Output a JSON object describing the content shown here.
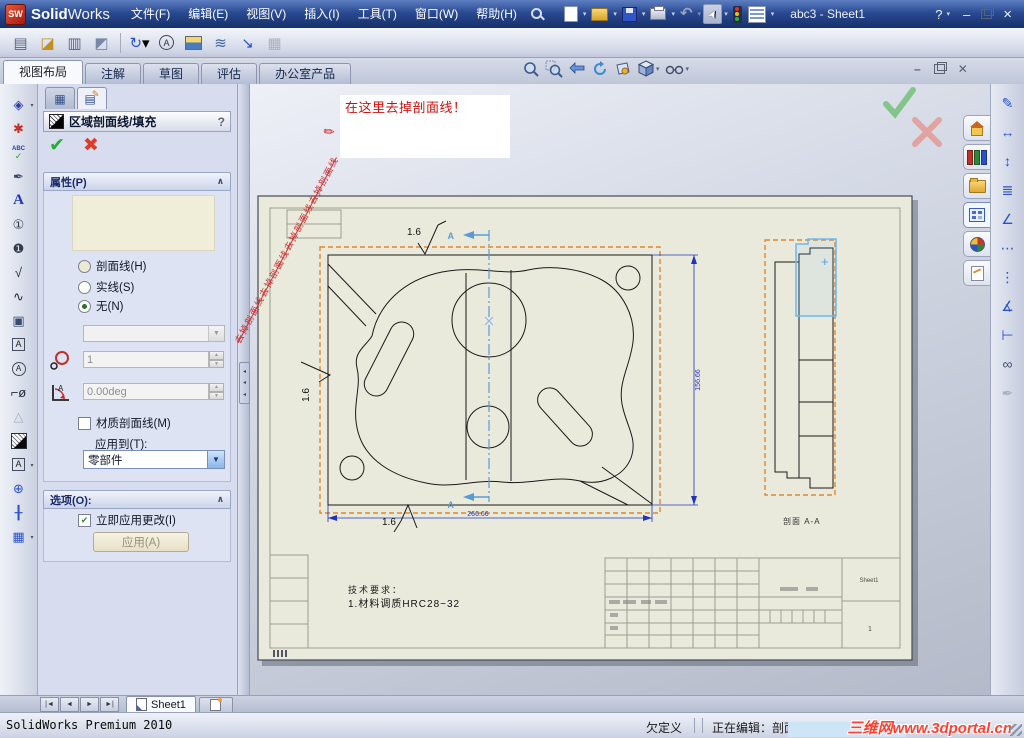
{
  "titlebar": {
    "logo_text": "SW",
    "brand_bold": "Solid",
    "brand_light": "Works",
    "menus": [
      "文件(F)",
      "编辑(E)",
      "视图(V)",
      "插入(I)",
      "工具(T)",
      "窗口(W)",
      "帮助(H)"
    ],
    "doc_title": "abc3 - Sheet1",
    "help_label": "?",
    "minimize": "–",
    "close": "×"
  },
  "quick_toolbar": [
    "new-document",
    "open-document",
    "save-document",
    "print-document",
    "undo",
    "select-cursor",
    "rebuild-traffic-light",
    "options-list"
  ],
  "standard_toolbar": [
    {
      "name": "new-drawing-view-icon",
      "glyph": "▤",
      "color": "#5a6480"
    },
    {
      "name": "model-view-icon",
      "glyph": "◪",
      "color": "#c09020"
    },
    {
      "name": "projected-view-icon",
      "glyph": "▥",
      "color": "#5a6480"
    },
    {
      "name": "auxiliary-view-icon",
      "glyph": "◩",
      "color": "#7a88a8",
      "sep_after": true
    },
    {
      "name": "update-view-icon",
      "glyph": "↻",
      "color": "#2a52c8",
      "dropdown": true
    },
    {
      "name": "detail-view-icon",
      "glyph": "A",
      "kind": "round",
      "color": "#334"
    },
    {
      "name": "section-view-icon",
      "kind": "landscape"
    },
    {
      "name": "break-view-icon",
      "glyph": "≋",
      "color": "#3a6aa8"
    },
    {
      "name": "crop-view-icon",
      "glyph": "↘",
      "color": "#2a52c8"
    },
    {
      "name": "empty-view-table-icon",
      "glyph": "▦",
      "color": "#a8b0c0",
      "disabled": true
    }
  ],
  "command_tabs": [
    {
      "label": "视图布局",
      "active": true
    },
    {
      "label": "注解",
      "active": false
    },
    {
      "label": "草图",
      "active": false
    },
    {
      "label": "评估",
      "active": false
    },
    {
      "label": "办公室产品",
      "active": false
    }
  ],
  "headsup_toolbar": [
    "zoom-to-fit",
    "zoom-to-area",
    "previous-view",
    "redraw",
    "3d-drawing-view",
    "view-orientation",
    "hide-show-items"
  ],
  "annotation_toolbar": [
    {
      "name": "smart-dimension-icon",
      "glyph": "◈",
      "color": "#2a3fb0",
      "dropdown": true
    },
    {
      "name": "model-items-icon",
      "glyph": "✱",
      "color": "#c03028"
    },
    {
      "name": "spell-checker-icon",
      "kind": "abc",
      "glyph": "ABC",
      "sub": "✓"
    },
    {
      "name": "format-painter-icon",
      "glyph": "✒",
      "color": "#3a4a70"
    },
    {
      "name": "note-icon",
      "glyph": "A",
      "color": "#2233bb",
      "kind": "bigA"
    },
    {
      "name": "balloon-icon",
      "glyph": "①",
      "color": "#333a4a"
    },
    {
      "name": "auto-balloon-icon",
      "glyph": "❶",
      "color": "#333a4a"
    },
    {
      "name": "surface-finish-icon",
      "glyph": "√",
      "color": "#222a3a"
    },
    {
      "name": "weld-symbol-icon",
      "glyph": "∿",
      "color": "#222a3a"
    },
    {
      "name": "hole-callout-icon",
      "glyph": "▣",
      "color": "#3a4a70"
    },
    {
      "name": "datum-feature-icon",
      "glyph": "A",
      "kind": "boxed"
    },
    {
      "name": "datum-target-icon",
      "glyph": "A",
      "kind": "round"
    },
    {
      "name": "geometric-tolerance-icon",
      "glyph": "⌐ø",
      "color": "#222a3a"
    },
    {
      "name": "revision-symbol-icon",
      "glyph": "△",
      "color": "#a8b0c0",
      "disabled": true
    },
    {
      "name": "area-hatch-fill-icon",
      "kind": "hatch"
    },
    {
      "name": "blocks-icon",
      "glyph": "A",
      "kind": "boxed",
      "dropdown": true
    },
    {
      "name": "center-mark-icon",
      "glyph": "⊕",
      "color": "#2a52c8"
    },
    {
      "name": "centerline-icon",
      "glyph": "╂",
      "color": "#2a52c8"
    },
    {
      "name": "tables-icon",
      "glyph": "▦",
      "color": "#2a52c8",
      "dropdown": true
    }
  ],
  "dimension_toolbar": [
    {
      "name": "smart-dimension-icon",
      "glyph": "✎",
      "color": "#2a52c8"
    },
    {
      "name": "horizontal-dimension-icon",
      "glyph": "↔",
      "color": "#2a52c8"
    },
    {
      "name": "vertical-dimension-icon",
      "glyph": "↕",
      "color": "#2a52c8"
    },
    {
      "name": "baseline-dimension-icon",
      "glyph": "≣",
      "color": "#2a52c8"
    },
    {
      "name": "ordinate-dimension-icon",
      "glyph": "∠",
      "color": "#2a52c8"
    },
    {
      "name": "horizontal-ordinate-icon",
      "glyph": "⋯",
      "color": "#2a52c8"
    },
    {
      "name": "vertical-ordinate-icon",
      "glyph": "⋮",
      "color": "#2a52c8"
    },
    {
      "name": "chamfer-dimension-icon",
      "glyph": "∡",
      "color": "#2a52c8"
    },
    {
      "name": "datum-dimension-icon",
      "glyph": "⊢",
      "color": "#2a52c8"
    },
    {
      "name": "hide-show-annotations-icon",
      "glyph": "∞",
      "color": "#44506a"
    },
    {
      "name": "format-painter-icon",
      "glyph": "✒",
      "color": "#a8b0c0",
      "disabled": true
    }
  ],
  "taskpane_tabs": [
    {
      "name": "solidworks-resources-tab",
      "icon": "home",
      "active": false
    },
    {
      "name": "design-library-tab",
      "icon": "books",
      "active": false
    },
    {
      "name": "file-explorer-tab",
      "icon": "folder",
      "active": false
    },
    {
      "name": "view-palette-tab",
      "icon": "palette",
      "active": true
    },
    {
      "name": "appearances-tab",
      "icon": "sphere",
      "active": false
    },
    {
      "name": "custom-properties-tab",
      "icon": "page",
      "active": false
    }
  ],
  "property_manager": {
    "title": "区域剖面线/填充",
    "help_label": "?",
    "properties_header": "属性(P)",
    "radio_h": "剖面线(H)",
    "radio_s": "实线(S)",
    "radio_n": "无(N)",
    "scale_value": "1",
    "angle_value": "0.00deg",
    "material_hatch_label": "材质剖面线(M)",
    "apply_to_label": "应用到(T):",
    "apply_to_value": "零部件",
    "options_header": "选项(O):",
    "apply_immediately_label": "立即应用更改(I)",
    "apply_button_label": "应用(A)"
  },
  "annotation_note": {
    "callout": "在这里去掉剖面线！",
    "diagonal": "去掉剖面线去掉剖面线去掉剖面线去掉剖面线"
  },
  "drawing": {
    "surface_finish": "1.6",
    "dim_vertical": "156.66",
    "dim_horizontal": "266.66",
    "section_letter": "A",
    "section_view_label": "剖面 A-A",
    "notes_title": "技术要求：",
    "notes_line": "1.材料调质HRC28~32",
    "titleblock_sheet": "Sheet1",
    "titleblock_page": "1"
  },
  "sheet_tab_label": "Sheet1",
  "statusbar": {
    "app_name": "SolidWorks Premium 2010",
    "define_status": "欠定义",
    "editing_status": "正在编辑：剖面视",
    "watermark": "三维网www.3dportal.cn"
  },
  "colors": {
    "accent_orange": "#E08830",
    "section_blue": "#5B9BD5",
    "dimension_blue": "#2233BB",
    "sheet_bg": "#EAEADC",
    "annotation_red": "#CC1111",
    "titlebar_blue": "#1E3A78"
  }
}
